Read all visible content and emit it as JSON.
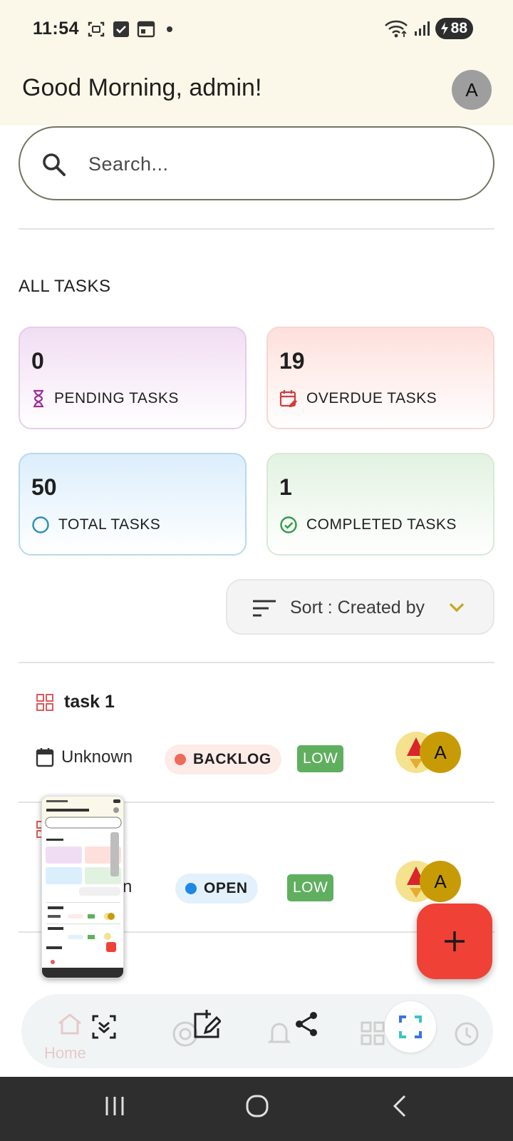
{
  "status_bar": {
    "time": "11:54",
    "battery": "88"
  },
  "header": {
    "greeting": "Good Morning, admin!",
    "avatar_initial": "A"
  },
  "search": {
    "placeholder": "Search..."
  },
  "section": {
    "title": "ALL TASKS"
  },
  "stats": {
    "pending": {
      "value": "0",
      "label": "PENDING TASKS"
    },
    "overdue": {
      "value": "19",
      "label": "OVERDUE TASKS"
    },
    "total": {
      "value": "50",
      "label": "TOTAL TASKS"
    },
    "completed": {
      "value": "1",
      "label": "COMPLETED TASKS"
    }
  },
  "sort": {
    "label": "Sort : Created by"
  },
  "tasks": [
    {
      "title": "task 1",
      "due": "Unknown",
      "status": "BACKLOG",
      "priority": "LOW",
      "assignee_initial": "A"
    },
    {
      "title": "",
      "due": "n",
      "status": "OPEN",
      "priority": "LOW",
      "assignee_initial": "A"
    }
  ],
  "bottom_nav": {
    "home_label": "Home"
  },
  "colors": {
    "header_bg": "#fbf8e9",
    "fab": "#ef4136",
    "priority_low": "#5faf5f",
    "status_backlog_dot": "#f06a5a",
    "status_open_dot": "#1e88e5"
  }
}
